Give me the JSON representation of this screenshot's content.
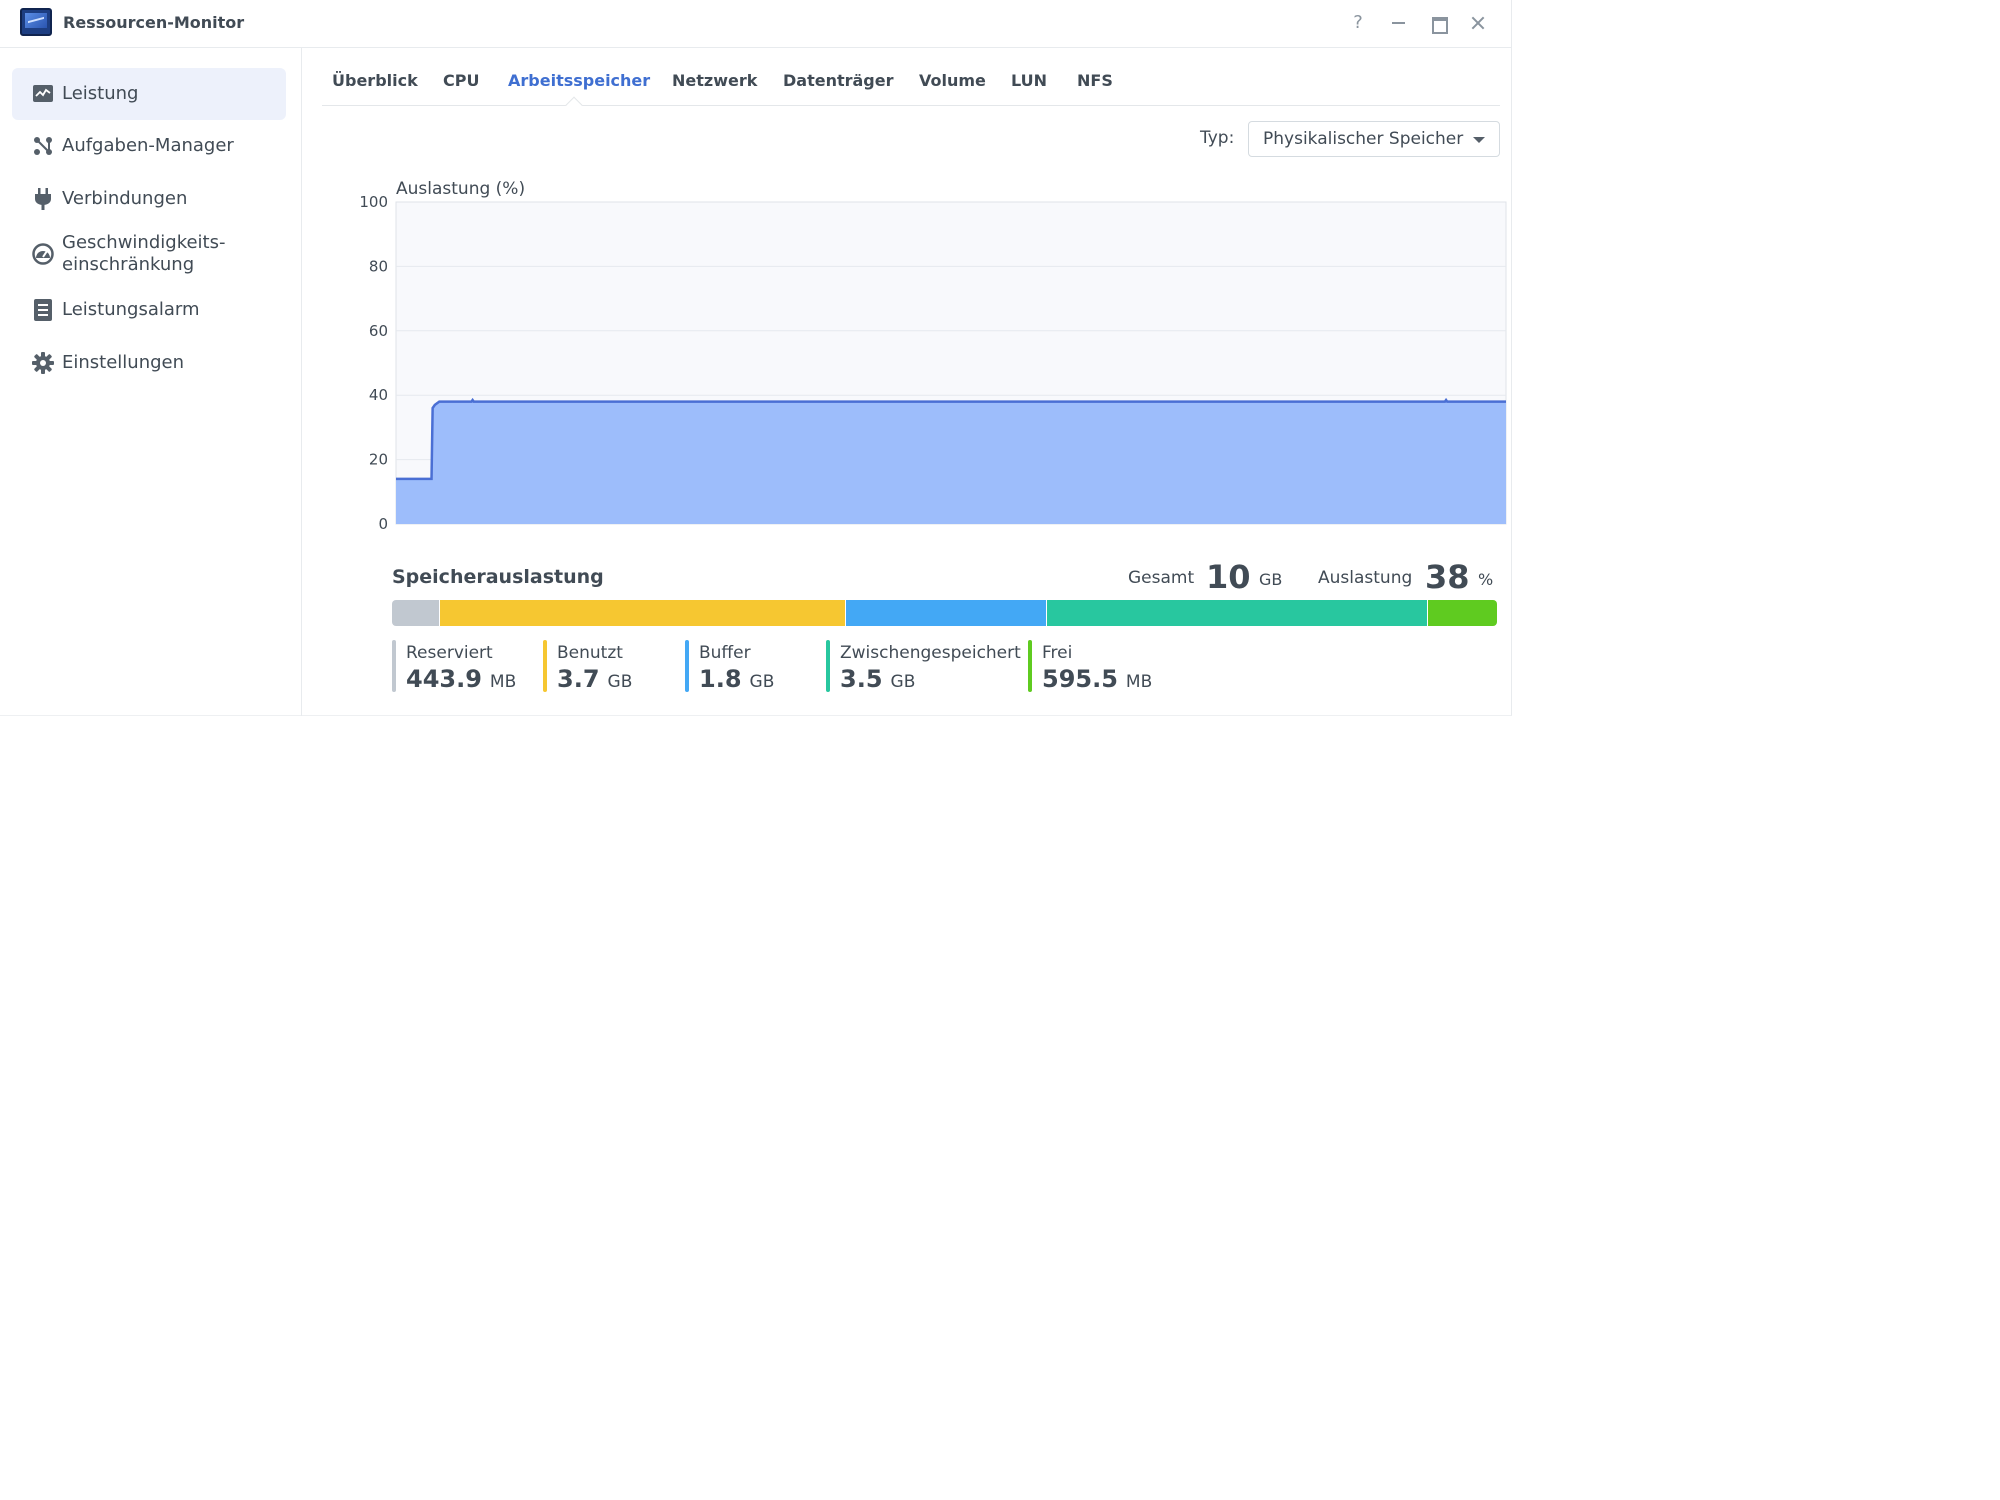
{
  "window": {
    "title": "Ressourcen-Monitor",
    "help_label": "?"
  },
  "sidebar": {
    "items": [
      {
        "label": "Leistung",
        "icon": "performance-chart-icon",
        "active": true
      },
      {
        "label": "Aufgaben-Manager",
        "icon": "task-manager-icon",
        "active": false
      },
      {
        "label": "Verbindungen",
        "icon": "plug-icon",
        "active": false
      },
      {
        "label_line1": "Geschwindigkeits-",
        "label_line2": "einschränkung",
        "icon": "speedometer-icon",
        "active": false
      },
      {
        "label": "Leistungsalarm",
        "icon": "alarm-list-icon",
        "active": false
      },
      {
        "label": "Einstellungen",
        "icon": "gear-icon",
        "active": false
      }
    ]
  },
  "tabs": {
    "items": [
      "Überblick",
      "CPU",
      "Arbeitsspeicher",
      "Netzwerk",
      "Datenträger",
      "Volume",
      "LUN",
      "NFS"
    ],
    "active": "Arbeitsspeicher"
  },
  "type_select": {
    "label": "Typ:",
    "value": "Physikalischer Speicher"
  },
  "chart_data": {
    "type": "area",
    "ylabel": "Auslastung (%)",
    "ylim": [
      0,
      100
    ],
    "yticks": [
      0,
      20,
      40,
      60,
      80,
      100
    ],
    "grid": true,
    "series": [
      {
        "points": [
          [
            0,
            14
          ],
          [
            3.2,
            14
          ],
          [
            3.3,
            36
          ],
          [
            3.5,
            37
          ],
          [
            3.9,
            38
          ],
          [
            6.8,
            38
          ],
          [
            6.9,
            38.5
          ],
          [
            7.0,
            38
          ],
          [
            94.5,
            38
          ],
          [
            94.6,
            38.5
          ],
          [
            94.7,
            38
          ],
          [
            100,
            38
          ]
        ]
      }
    ],
    "colors": {
      "line": "#4a6fd4",
      "fill": "#9dbdfb",
      "plot_bg": "#f8f9fc",
      "grid": "#e6e9ee"
    }
  },
  "memory": {
    "title": "Speicherauslastung",
    "total_label": "Gesamt",
    "total_value": "10",
    "total_unit": "GB",
    "util_label": "Auslastung",
    "util_value": "38",
    "util_unit": "%",
    "segments": [
      {
        "name": "Reserviert",
        "value": "443.9",
        "unit": "MB",
        "color": "#c1c8d0",
        "fraction": 0.0434
      },
      {
        "name": "Benutzt",
        "value": "3.7",
        "unit": "GB",
        "color": "#f6c731",
        "fraction": 0.3673
      },
      {
        "name": "Buffer",
        "value": "1.8",
        "unit": "GB",
        "color": "#43a8f5",
        "fraction": 0.1818
      },
      {
        "name": "Zwischengespeichert",
        "value": "3.5",
        "unit": "GB",
        "color": "#28c79f",
        "fraction": 0.3455
      },
      {
        "name": "Frei",
        "value": "595.5",
        "unit": "MB",
        "color": "#5fcb20",
        "fraction": 0.062
      }
    ]
  }
}
